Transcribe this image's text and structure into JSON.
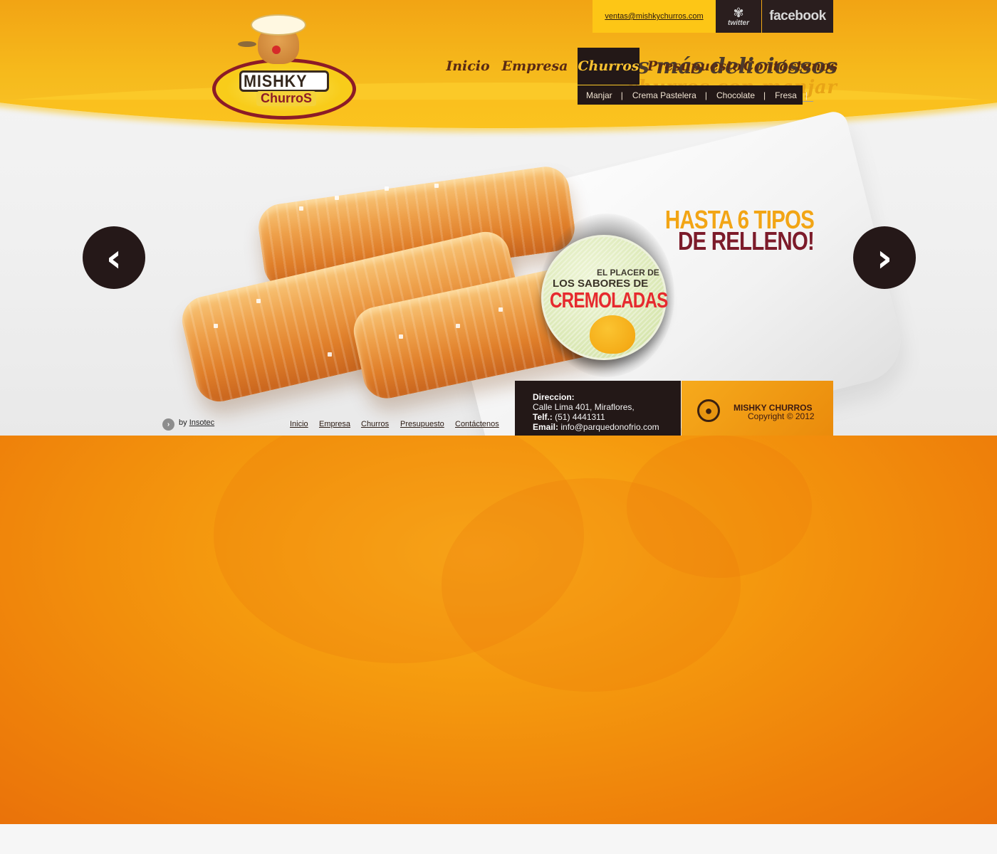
{
  "brand": {
    "name": "MISHKY",
    "sub": "ChurroS"
  },
  "topbar": {
    "email": "ventas@mishkychurros.com",
    "twitter_label": "twitter",
    "facebook_label": "facebook",
    "twitter_icon": "bird-icon"
  },
  "nav": {
    "items": [
      {
        "label": "Inicio"
      },
      {
        "label": "Empresa"
      },
      {
        "label": "Churros"
      },
      {
        "label": "Presupuesto"
      },
      {
        "label": "Contáctenos"
      }
    ],
    "active": "Churros",
    "submenu": [
      {
        "label": "Manjar"
      },
      {
        "label": "Crema Pastelera"
      },
      {
        "label": "Chocolate"
      },
      {
        "label": "Fresa"
      }
    ],
    "separator": "|"
  },
  "hero": {
    "tagline_line1": "¡Los más deliciossos",
    "tagline_line2": "churros con manjar",
    "promo_line1": "HASTA 6 TIPOS",
    "promo_line2": "DE RELLENO!",
    "badge_line1": "EL PLACER DE",
    "badge_line2": "LOS SABORES DE",
    "badge_line3": "CREMOLADAS",
    "prev_arrow": "‹",
    "next_arrow": "›"
  },
  "footer": {
    "by_label": "by",
    "by_link": "Insotec",
    "links": [
      "Inicio",
      "Empresa",
      "Churros",
      "Presupuesto",
      "Contáctenos"
    ],
    "contact": {
      "address_label": "Direccion:",
      "address": "Calle Lima 401, Miraflores,",
      "phone_label": "Telf.:",
      "phone": "(51) 4441311",
      "email_label": "Email:",
      "email": "info@parquedonofrio.com"
    },
    "copyright_name": "MISHKY CHURROS",
    "copyright_line": "Copyright ©  2012"
  },
  "colors": {
    "brand_yellow": "#f6ba1c",
    "dark_brown": "#231817",
    "orange": "#ee7f0a",
    "promo_red": "#7c1b2a",
    "accent_red": "#e62a2e"
  }
}
